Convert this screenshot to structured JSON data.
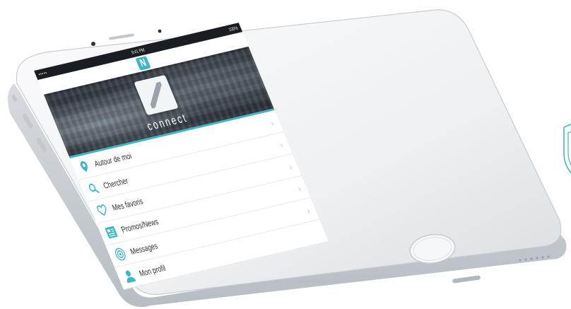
{
  "status_bar": {
    "carrier": "•••••  ",
    "time": "9:41 PM",
    "battery": "100%"
  },
  "header": {
    "logo_letter": "N"
  },
  "hero": {
    "title": "connect"
  },
  "menu": {
    "items": [
      {
        "label": "Autour de moi",
        "icon": "location-pin-icon"
      },
      {
        "label": "Chercher",
        "icon": "search-icon"
      },
      {
        "label": "Mes favoris",
        "icon": "heart-icon"
      },
      {
        "label": "Promos/News",
        "icon": "newspaper-icon"
      },
      {
        "label": "Messages",
        "icon": "broadcast-icon"
      },
      {
        "label": "Mon profil",
        "icon": "user-icon"
      }
    ],
    "chevron": "›"
  },
  "colors": {
    "accent": "#3fb6c6",
    "phone_body": "#f1f2f3",
    "phone_edge": "#c9cdd1"
  }
}
